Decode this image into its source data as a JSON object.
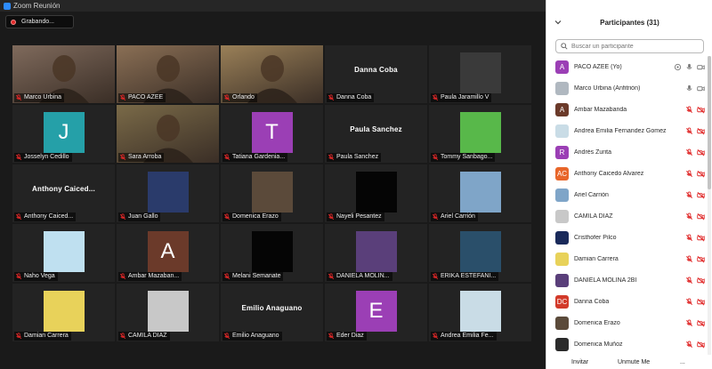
{
  "window": {
    "title": "Zoom Reunión"
  },
  "recording": {
    "label": "Grabando..."
  },
  "gallery": {
    "tiles": [
      {
        "name": "Marco Urbina",
        "kind": "video",
        "active": true,
        "bg": "#7f6a5c"
      },
      {
        "name": "PACO AZEE",
        "kind": "video",
        "active": false,
        "bg": "#8a6f55"
      },
      {
        "name": "Orlando",
        "kind": "video",
        "active": false,
        "bg": "#9a8058"
      },
      {
        "name": "Danna Coba",
        "kind": "namecard",
        "active": false
      },
      {
        "name": "Paula Jaramillo V",
        "kind": "image",
        "active": false,
        "bg": "#3a3a3a"
      },
      {
        "name": "Josselyn Cedillo",
        "kind": "letter",
        "letter": "J",
        "bg": "#25a0a8"
      },
      {
        "name": "Sara Arroba",
        "kind": "video",
        "active": false,
        "bg": "#7a6a48"
      },
      {
        "name": "Tatiana Gardenia...",
        "kind": "letter",
        "letter": "T",
        "bg": "#9b3fb5"
      },
      {
        "name": "Paula Sanchez",
        "kind": "namecard",
        "active": false
      },
      {
        "name": "Tommy Sanbago...",
        "kind": "image",
        "bg": "#58b84a"
      },
      {
        "name": "Anthony  Caiced...",
        "kind": "namecard",
        "active": false
      },
      {
        "name": "Juan Gallo",
        "kind": "image",
        "bg": "#2a3b6b"
      },
      {
        "name": "Domenica Erazo",
        "kind": "image",
        "bg": "#5b4a3a"
      },
      {
        "name": "Nayeli Pesantez",
        "kind": "image",
        "bg": "#050505"
      },
      {
        "name": "Ariel Carrión",
        "kind": "image",
        "bg": "#7fa5c8"
      },
      {
        "name": "Naho Vega",
        "kind": "image",
        "bg": "#bfe0f0"
      },
      {
        "name": "Ambar Mazaban...",
        "kind": "letter",
        "letter": "A",
        "bg": "#6b3a2a"
      },
      {
        "name": "Melani Semanate",
        "kind": "image",
        "bg": "#050505"
      },
      {
        "name": "DANIELA MOLIN...",
        "kind": "image",
        "bg": "#5a3f7a"
      },
      {
        "name": "ERIKA ESTEFANI...",
        "kind": "image",
        "bg": "#2a4f6a"
      },
      {
        "name": "Damian Carrera",
        "kind": "image",
        "bg": "#e8d25a"
      },
      {
        "name": "CAMILA DIAZ",
        "kind": "image",
        "bg": "#c8c8c8"
      },
      {
        "name": "Emilio Anaguano",
        "kind": "namecard",
        "active": false
      },
      {
        "name": "Eder Diaz",
        "kind": "letter",
        "letter": "E",
        "bg": "#9b3fb5"
      },
      {
        "name": "Andrea Emilia Fe...",
        "kind": "image",
        "bg": "#c9dce6"
      }
    ]
  },
  "panel": {
    "title": "Participantes (31)",
    "search_placeholder": "Buscar un participante",
    "participants": [
      {
        "name": "PACO AZEE (Yo)",
        "avatar": "A",
        "color": "#9b3fb5",
        "mic": "on",
        "video": "on",
        "self": true
      },
      {
        "name": "Marco Urbina (Anfitrión)",
        "avatar": "",
        "color": "#b0b8c0",
        "mic": "on",
        "video": "on"
      },
      {
        "name": "Ambar Mazabanda",
        "avatar": "A",
        "color": "#6b3a2a",
        "mic": "off",
        "video": "off"
      },
      {
        "name": "Andrea Emilia Fernandez Gomez",
        "avatar": "",
        "color": "#c9dce6",
        "mic": "off",
        "video": "off"
      },
      {
        "name": "Andrés Zurita",
        "avatar": "R",
        "color": "#9b3fb5",
        "mic": "off",
        "video": "off"
      },
      {
        "name": "Anthony Caicedo Alvarez",
        "avatar": "AC",
        "color": "#e8662a",
        "mic": "off",
        "video": "off"
      },
      {
        "name": "Ariel Carrión",
        "avatar": "",
        "color": "#7fa5c8",
        "mic": "off",
        "video": "off"
      },
      {
        "name": "CAMILA DIAZ",
        "avatar": "",
        "color": "#c8c8c8",
        "mic": "off",
        "video": "off"
      },
      {
        "name": "Cristhofer Pilco",
        "avatar": "",
        "color": "#1a2a5a",
        "mic": "off",
        "video": "off"
      },
      {
        "name": "Damian Carrera",
        "avatar": "",
        "color": "#e8d25a",
        "mic": "off",
        "video": "off"
      },
      {
        "name": "DANIELA MOLINA 2BI",
        "avatar": "",
        "color": "#5a3f7a",
        "mic": "off",
        "video": "off"
      },
      {
        "name": "Danna Coba",
        "avatar": "DC",
        "color": "#d23a2a",
        "mic": "off",
        "video": "off"
      },
      {
        "name": "Domenica Erazo",
        "avatar": "",
        "color": "#5b4a3a",
        "mic": "off",
        "video": "off"
      },
      {
        "name": "Domenica Muñoz",
        "avatar": "",
        "color": "#2a2a2a",
        "mic": "off",
        "video": "off"
      }
    ],
    "footer": {
      "invite": "Invitar",
      "unmute_all": "Unmute Me",
      "more": "..."
    }
  },
  "colors": {
    "mic_off": "#e02828",
    "accent": "#2d8cff",
    "active_speaker": "#a8d94a"
  }
}
